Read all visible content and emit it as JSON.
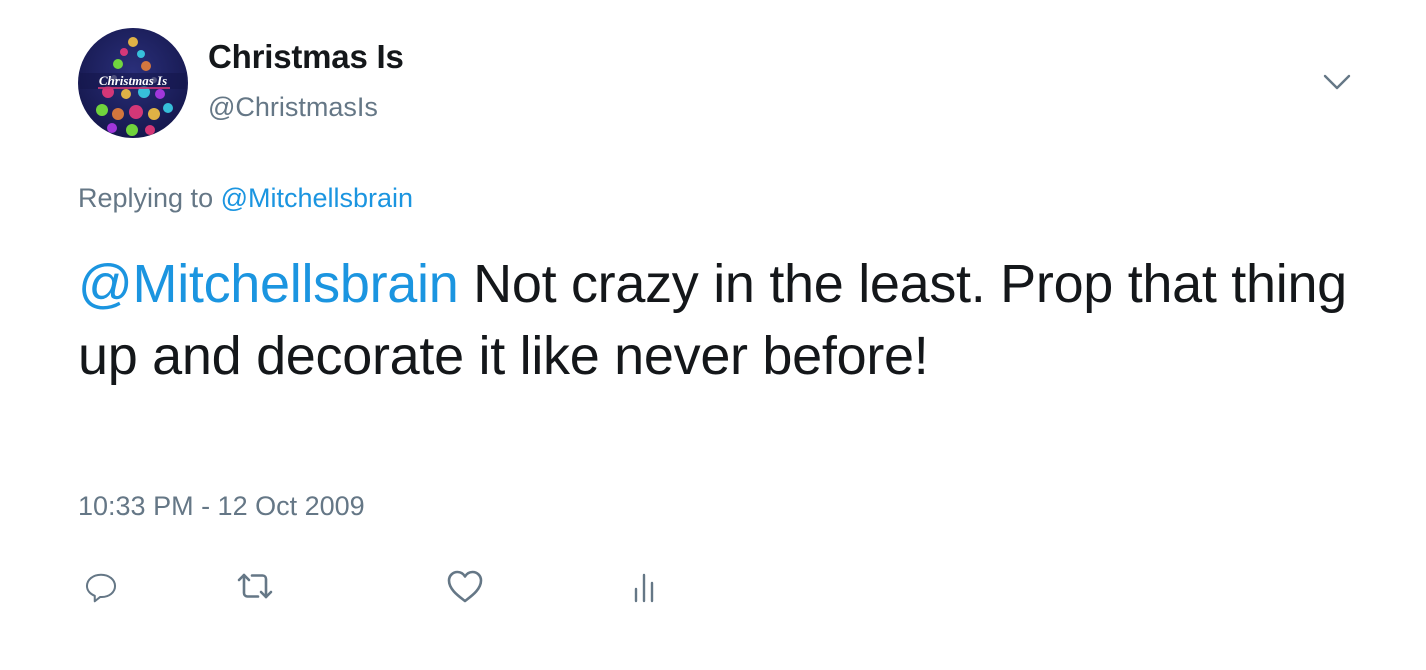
{
  "author": {
    "display_name": "Christmas Is",
    "handle": "@ChristmasIs",
    "avatar_text": "Christmas Is",
    "avatar_colors": {
      "bg": "#1c1f5e",
      "accent": "#e83a7a",
      "light": "#f6c343"
    }
  },
  "reply": {
    "prefix": "Replying to",
    "mention": "@Mitchellsbrain"
  },
  "body": {
    "mention": "@Mitchellsbrain",
    "text": " Not crazy in the least. Prop that thing up and decorate it like never before!"
  },
  "timestamp": "10:33 PM - 12 Oct 2009",
  "actions": {
    "reply": "reply-icon",
    "retweet": "retweet-icon",
    "like": "heart-icon",
    "analytics": "analytics-icon"
  },
  "menu": {
    "icon": "chevron-down-icon"
  },
  "colors": {
    "link": "#1b95e0",
    "secondary": "#657786",
    "text": "#14171a",
    "icon": "#657786"
  }
}
